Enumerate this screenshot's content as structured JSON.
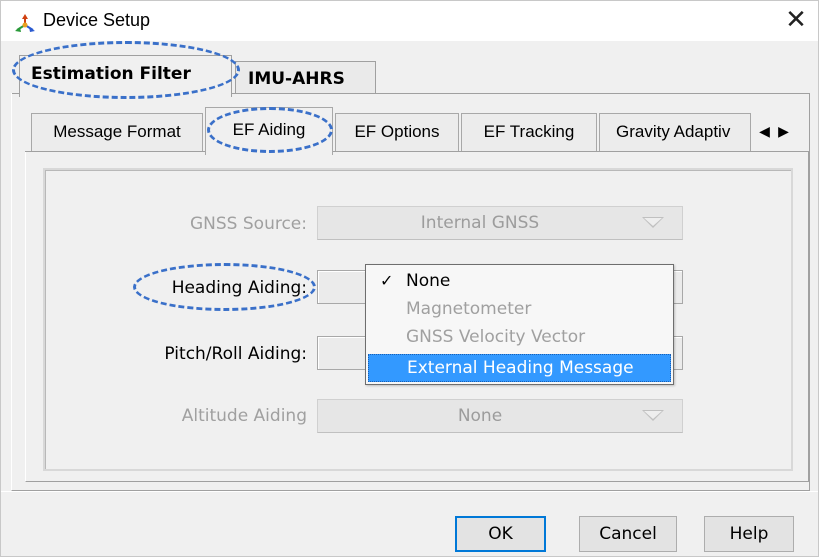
{
  "window": {
    "title": "Device Setup",
    "close_glyph": "✕",
    "app_icon": "device-setup-icon"
  },
  "outer_tabs": [
    {
      "label": "Estimation Filter",
      "selected": true
    },
    {
      "label": "IMU-AHRS",
      "selected": false
    }
  ],
  "inner_tabs": [
    {
      "label": "Message Format",
      "selected": false
    },
    {
      "label": "EF Aiding",
      "selected": true
    },
    {
      "label": "EF Options",
      "selected": false
    },
    {
      "label": "EF Tracking",
      "selected": false
    },
    {
      "label": "Gravity Adaptiv",
      "selected": false
    }
  ],
  "tab_scroll": {
    "left_glyph": "◀",
    "right_glyph": "▶"
  },
  "fields": {
    "gnss_source": {
      "label": "GNSS Source:",
      "value": "Internal GNSS",
      "enabled": false
    },
    "heading_aiding": {
      "label": "Heading Aiding:",
      "value": "",
      "enabled": true
    },
    "pitch_roll_aiding": {
      "label": "Pitch/Roll Aiding:",
      "value": "",
      "enabled": true
    },
    "altitude_aiding": {
      "label": "Altitude Aiding",
      "value": "None",
      "enabled": false
    }
  },
  "heading_dropdown": {
    "check_glyph": "✓",
    "options": [
      {
        "label": "None",
        "checked": true,
        "enabled": true,
        "highlighted": false
      },
      {
        "label": "Magnetometer",
        "checked": false,
        "enabled": false,
        "highlighted": false
      },
      {
        "label": "GNSS Velocity Vector",
        "checked": false,
        "enabled": false,
        "highlighted": false
      },
      {
        "label": "External Heading Message",
        "checked": false,
        "enabled": true,
        "highlighted": true
      }
    ]
  },
  "buttons": {
    "ok": "OK",
    "cancel": "Cancel",
    "help": "Help"
  },
  "colors": {
    "annotation": "#3a70c9",
    "highlight": "#3399ff",
    "disabled_text": "#a0a0a0",
    "default_button_border": "#0078d7"
  }
}
